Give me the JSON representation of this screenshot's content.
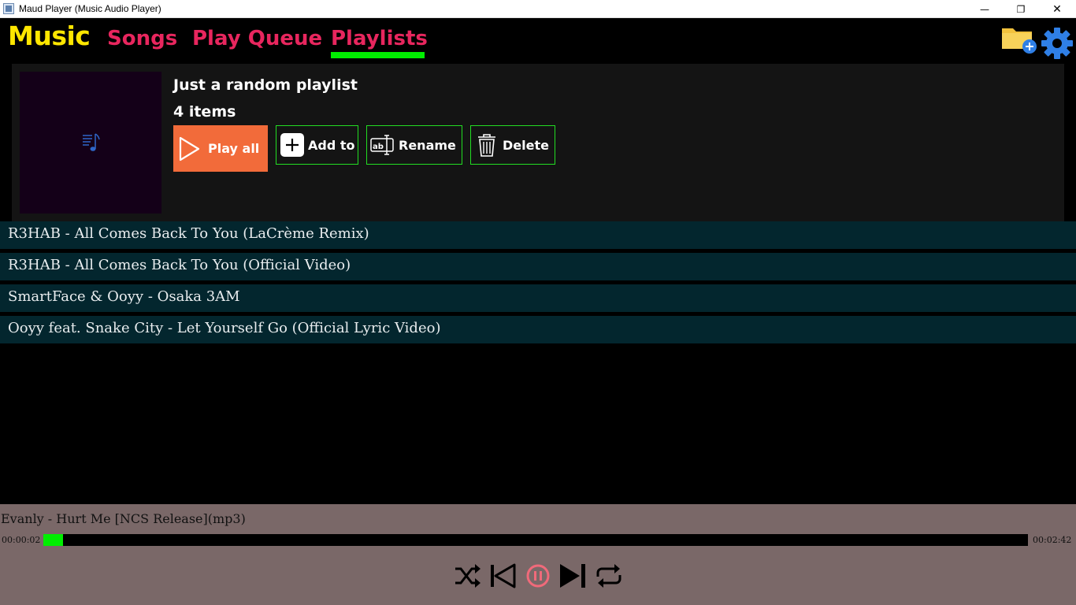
{
  "window": {
    "title": "Maud Player (Music Audio Player)",
    "minimize": "—",
    "maximize": "❐",
    "close": "✕"
  },
  "nav": {
    "brand": "Music",
    "tabs": [
      "Songs",
      "Play Queue",
      "Playlists"
    ],
    "active_tab": "Playlists",
    "colors": {
      "brand": "#ffe600",
      "tab": "#e8265e",
      "active_underline": "#00ee00"
    }
  },
  "toolbar_icons": [
    "folder-add-icon",
    "gear-icon"
  ],
  "playlist": {
    "title": "Just a random playlist",
    "count_label": "4 items",
    "buttons": {
      "play_all": "Play all",
      "add_to": "Add to",
      "rename": "Rename",
      "delete": "Delete"
    },
    "colors": {
      "play_all_bg": "#f26b3a",
      "button_border": "#22dd22",
      "art_bg": "#140018"
    }
  },
  "tracks": [
    "R3HAB - All Comes Back To You (LaCrème Remix)",
    "R3HAB - All Comes Back To You (Official Video)",
    "SmartFace & Ooyy - Osaka 3AM",
    "Ooyy feat. Snake City - Let Yourself Go (Official Lyric Video)"
  ],
  "player": {
    "now_playing": "Evanly - Hurt Me [NCS Release](mp3)",
    "elapsed": "00:00:02",
    "total": "00:02:42",
    "progress_fraction": 0.02,
    "state": "playing",
    "controls": [
      "shuffle-icon",
      "previous-icon",
      "pause-icon",
      "next-icon",
      "repeat-icon"
    ],
    "colors": {
      "bar_bg": "#7a6868",
      "progress": "#00ee00",
      "pause": "#f06a7a"
    }
  }
}
